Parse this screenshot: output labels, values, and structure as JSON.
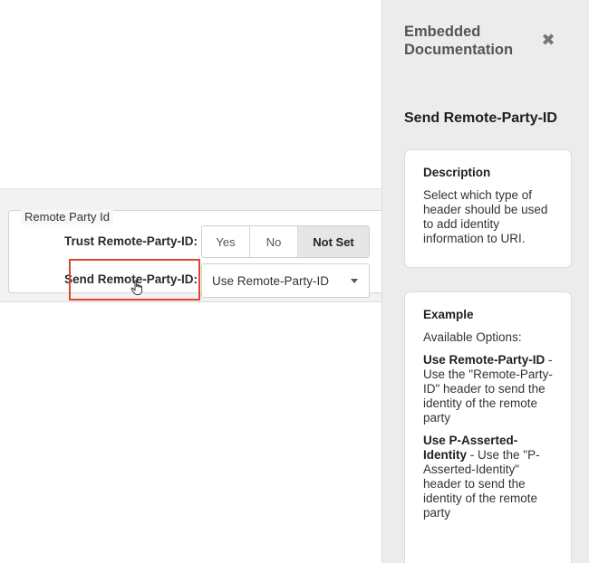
{
  "form": {
    "section_legend": "Remote Party Id",
    "trust": {
      "label": "Trust Remote-Party-ID:",
      "options": [
        "Yes",
        "No",
        "Not Set"
      ],
      "selected": "Not Set"
    },
    "send": {
      "label": "Send Remote-Party-ID:",
      "value": "Use Remote-Party-ID"
    },
    "highlight_color": "#e0452a"
  },
  "doc": {
    "title": "Embedded Documentation",
    "close_icon": "close-x-icon",
    "heading": "Send Remote-Party-ID",
    "description": {
      "title": "Description",
      "text": "Select which type of header should be used to add identity information to URI."
    },
    "example": {
      "title": "Example",
      "intro": "Available Options:",
      "options": [
        {
          "name": "Use Remote-Party-ID",
          "text": " - Use the \"Remote-Party-ID\" header to send the identity of the remote party"
        },
        {
          "name": "Use P-Asserted-Identity",
          "text": " - Use the \"P-Asserted-Identity\" header to send the identity of the remote party"
        }
      ]
    }
  }
}
